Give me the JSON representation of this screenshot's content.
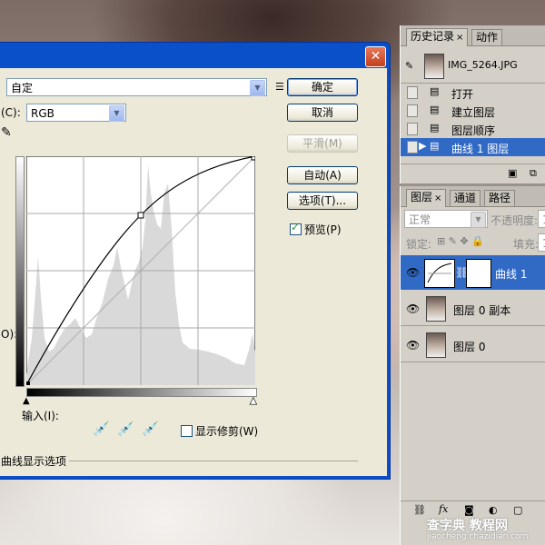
{
  "dialog": {
    "preset_value": "自定",
    "channel_label": "(C):",
    "channel_value": "RGB",
    "buttons": {
      "ok": "确定",
      "cancel": "取消",
      "smooth": "平滑(M)",
      "auto": "自动(A)",
      "options": "选项(T)..."
    },
    "preview_label": "预览(P)",
    "input_label": "输入(I):",
    "output_label": "O):",
    "show_clipping_label": "显示修剪(W)",
    "curve_display_label": "曲线显示选项"
  },
  "history_panel": {
    "tabs": [
      "历史记录",
      "动作"
    ],
    "snapshot_name": "IMG_5264.JPG",
    "items": [
      "打开",
      "建立图层",
      "图层顺序",
      "曲线 1 图层"
    ],
    "selected_index": 3
  },
  "layers_panel": {
    "tabs": [
      "图层",
      "通道",
      "路径"
    ],
    "blend_mode": "正常",
    "opacity_label": "不透明度:",
    "opacity_value": "1",
    "lock_label": "锁定:",
    "fill_label": "填充:",
    "fill_value": "1",
    "layers": [
      "曲线 1",
      "图层 0 副本",
      "图层 0"
    ],
    "selected_index": 0
  },
  "watermark": {
    "line1": "查字典 教程网",
    "line2": "jiaocheng.chazidian.com"
  },
  "colors": {
    "titlebar": "#0a50c8",
    "dialog_bg": "#ece9d8",
    "selection": "#316ac5",
    "close_button": "#d55c3a"
  }
}
